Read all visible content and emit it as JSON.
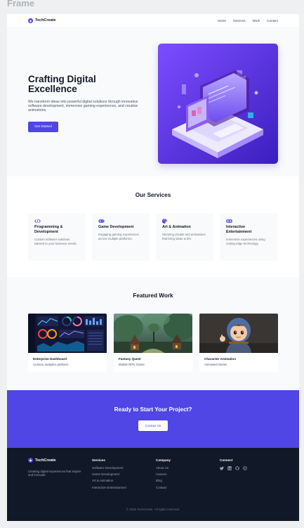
{
  "frame_label": "Frame",
  "brand": {
    "name": "TechCreate",
    "logo_icon": "techcreate-logo-icon",
    "accent": "#4f46e5"
  },
  "nav": {
    "links": [
      "Home",
      "Services",
      "Work",
      "Contact"
    ]
  },
  "hero": {
    "title": "Crafting Digital Excellence",
    "subtitle": "We transform ideas into powerful digital solutions through innovative software development, immersive gaming experiences, and creative animations.",
    "button": "Get Started",
    "illustration_icon": "isometric-computer-illustration"
  },
  "services": {
    "title": "Our Services",
    "items": [
      {
        "icon": "code-icon",
        "name": "Programming & Development",
        "desc": "Custom software solutions tailored to your business needs."
      },
      {
        "icon": "gamepad-icon",
        "name": "Game Development",
        "desc": "Engaging gaming experiences across multiple platforms."
      },
      {
        "icon": "palette-icon",
        "name": "Art & Animation",
        "desc": "Stunning visuals and animations that bring ideas to life."
      },
      {
        "icon": "vr-headset-icon",
        "name": "Interactive Entertainment",
        "desc": "Immersive experiences using cutting-edge technology."
      }
    ]
  },
  "work": {
    "title": "Featured Work",
    "items": [
      {
        "image": "dashboard-thumbnail",
        "name": "Enterprise Dashboard",
        "sub": "Custom analytics platform"
      },
      {
        "image": "fantasy-village-thumbnail",
        "name": "Fantasy Quest",
        "sub": "Mobile RPG Game"
      },
      {
        "image": "character-thumbnail",
        "name": "Character Animation",
        "sub": "Animated Series"
      }
    ]
  },
  "cta": {
    "title": "Ready to Start Your Project?",
    "button": "Contact Us"
  },
  "footer": {
    "tagline": "Creating digital experiences that inspire and innovate.",
    "services": {
      "heading": "Services",
      "links": [
        "Software Development",
        "Game Development",
        "Art & Animation",
        "Interactive Entertainment"
      ]
    },
    "company": {
      "heading": "Company",
      "links": [
        "About Us",
        "Careers",
        "Blog",
        "Contact"
      ]
    },
    "connect": {
      "heading": "Connect",
      "icons": [
        "twitter-icon",
        "linkedin-icon",
        "github-icon",
        "dribbble-icon"
      ]
    },
    "copyright": "© 2025 TechCreate. All rights reserved."
  }
}
